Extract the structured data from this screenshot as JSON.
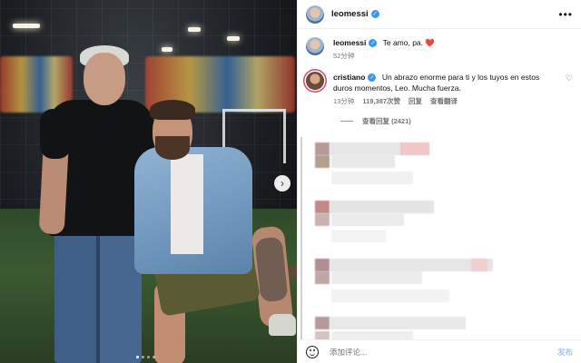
{
  "post": {
    "username": "leomessi",
    "more_icon": "more-horizontal-icon"
  },
  "caption": {
    "username": "leomessi",
    "text": "Te amo, pa.",
    "emoji": "❤️",
    "time": "52分钟"
  },
  "comment": {
    "username": "cristiano",
    "text": "Un abrazo enorme para ti y los tuyos en estos duros momentos, Leo. Mucha fuerza.",
    "time": "13分钟",
    "likes": "119,387次赞",
    "reply_label": "回复",
    "translate_label": "查看翻译",
    "view_replies": "查看回复 (2421)"
  },
  "composer": {
    "placeholder": "添加评论...",
    "post_label": "发布"
  },
  "colors": {
    "verified": "#3897f0",
    "heart": "#e0245e",
    "post_button": "#9cc8f5"
  }
}
